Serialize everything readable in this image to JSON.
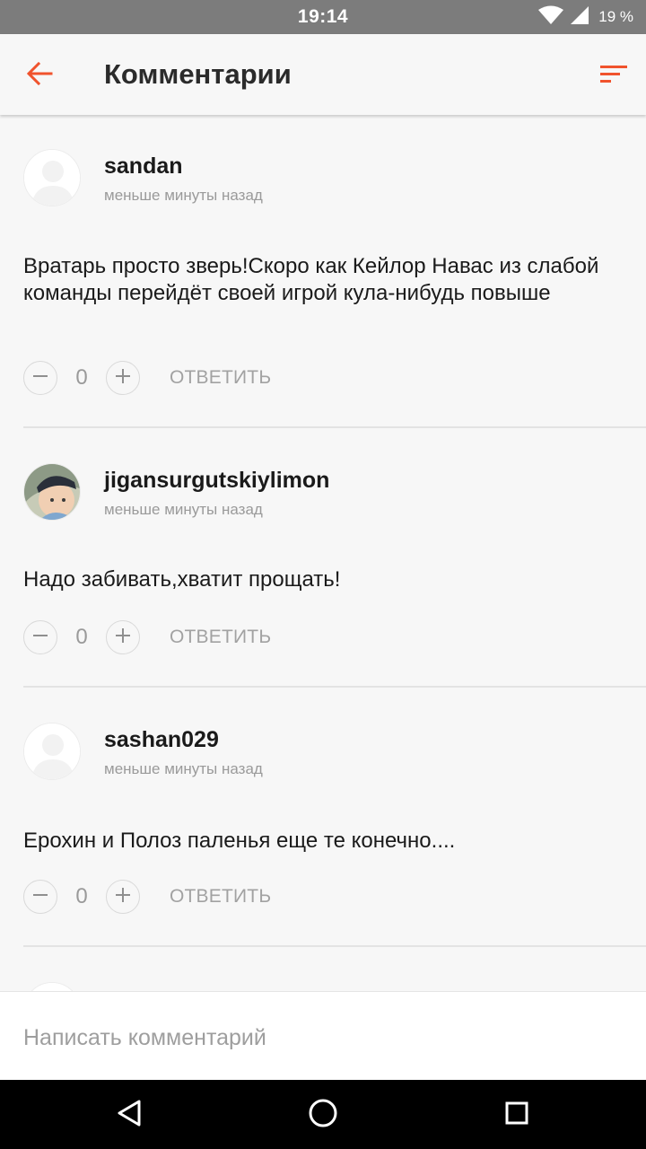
{
  "status_bar": {
    "time": "19:14",
    "battery": "19 %",
    "icons": [
      "wifi-icon",
      "signal-icon"
    ]
  },
  "app_bar": {
    "title": "Комментарии",
    "back_icon": "arrow-left-icon",
    "sort_icon": "sort-icon",
    "accent": "#f0532d"
  },
  "comments": [
    {
      "author": "sandan",
      "time": "меньше минуты назад",
      "text": "Вратарь просто зверь!Скоро как Кейлор Навас из слабой команды перейдёт своей игрой кула-нибудь повыше",
      "votes": "0",
      "reply_label": "ОТВЕТИТЬ",
      "avatar": "default-avatar"
    },
    {
      "author": "jigansurgutskiylimon",
      "time": "меньше минуты назад",
      "text": "Надо забивать,хватит прощать!",
      "votes": "0",
      "reply_label": "ОТВЕТИТЬ",
      "avatar": "photo-avatar"
    },
    {
      "author": "sashan029",
      "time": "меньше минуты назад",
      "text": "Ерохин и Полоз паленья еще те конечно....",
      "votes": "0",
      "reply_label": "ОТВЕТИТЬ",
      "avatar": "default-avatar"
    }
  ],
  "composer": {
    "placeholder": "Написать комментарий"
  },
  "nav_bar": {
    "icons": [
      "back-triangle-icon",
      "home-circle-icon",
      "recents-square-icon"
    ]
  }
}
